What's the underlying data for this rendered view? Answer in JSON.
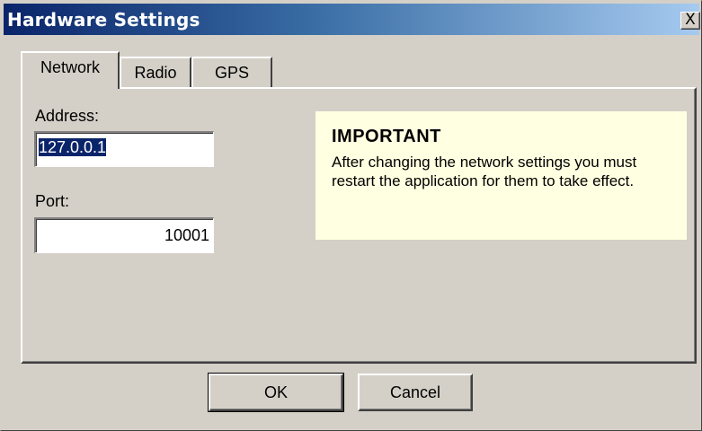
{
  "window": {
    "title": "Hardware Settings",
    "close_label": "X"
  },
  "tabs": [
    {
      "label": "Network",
      "active": true
    },
    {
      "label": "Radio",
      "active": false
    },
    {
      "label": "GPS",
      "active": false
    }
  ],
  "network": {
    "address_label": "Address:",
    "address_value": "127.0.0.1",
    "port_label": "Port:",
    "port_value": "10001"
  },
  "notice": {
    "title": "IMPORTANT",
    "body": "After changing the network settings you must restart the application for them to take effect."
  },
  "buttons": {
    "ok": "OK",
    "cancel": "Cancel"
  },
  "colors": {
    "title_start": "#0a246a",
    "title_end": "#a6caf0",
    "face": "#d4d0c8",
    "notice_bg": "#ffffe1",
    "selection": "#0a246a"
  }
}
